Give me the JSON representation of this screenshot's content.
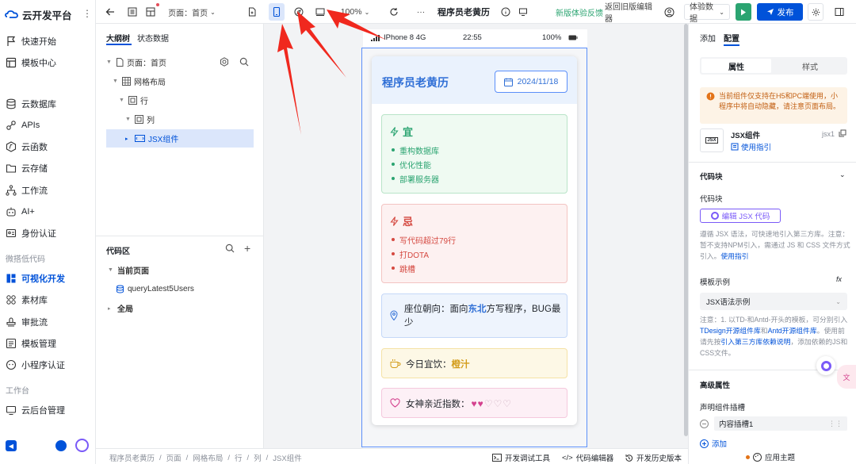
{
  "app": {
    "brand": "云开发平台"
  },
  "nav": {
    "items": [
      {
        "label": "快速开始"
      },
      {
        "label": "模板中心"
      },
      {
        "label": "云数据库"
      },
      {
        "label": "APIs"
      },
      {
        "label": "云函数"
      },
      {
        "label": "云存储"
      },
      {
        "label": "工作流"
      },
      {
        "label": "AI+"
      },
      {
        "label": "身份认证"
      },
      {
        "label": "可视化开发"
      },
      {
        "label": "素材库"
      },
      {
        "label": "审批流"
      },
      {
        "label": "模板管理"
      },
      {
        "label": "小程序认证"
      },
      {
        "label": "云后台管理"
      }
    ],
    "section_lowcode": "微搭低代码",
    "section_workbench": "工作台"
  },
  "topbar": {
    "page_select": "页面：首页",
    "zoom": "100%",
    "more": "···",
    "app_title": "程序员老黄历",
    "feedback": "新版体验反馈",
    "back_old": "返回旧版编辑器",
    "exp_data": "体验数据",
    "publish": "发布",
    "h5_tooltip": "H5"
  },
  "tree": {
    "tabs": [
      "大纲树",
      "状态数据"
    ],
    "rows": [
      {
        "label": "页面：首页"
      },
      {
        "label": "网格布局"
      },
      {
        "label": "行"
      },
      {
        "label": "列"
      },
      {
        "label": "JSX组件"
      }
    ],
    "code_title": "代码区",
    "code_rows": [
      {
        "label": "当前页面"
      },
      {
        "label": "queryLatest5Users"
      },
      {
        "label": "全局"
      }
    ]
  },
  "phone": {
    "status": {
      "device": "IPhone 8  4G",
      "time": "22:55",
      "battery": "100%"
    },
    "title": "程序员老黄历",
    "date": "2024/11/18",
    "yi": {
      "title": "宜",
      "items": [
        "重构数据库",
        "优化性能",
        "部署服务器"
      ]
    },
    "ji": {
      "title": "忌",
      "items": [
        "写代码超过79行",
        "打DOTA",
        "跳槽"
      ]
    },
    "seat": {
      "prefix": "座位朝向：面向",
      "dir": "东北",
      "suffix": "方写程序，BUG最少"
    },
    "drink": {
      "prefix": "今日宜饮：",
      "value": "橙汁"
    },
    "goddess": {
      "prefix": "女神亲近指数：",
      "filled": 2,
      "total": 5
    }
  },
  "right": {
    "tabs": [
      "添加",
      "配置"
    ],
    "subtabs": [
      "属性",
      "样式"
    ],
    "warning": "当前组件仅支持在H5和PC端使用，小程序中将自动隐藏，请注意页面布局。",
    "component_name": "JSX组件",
    "component_id": "jsx1",
    "component_badge": "JSX",
    "guide": "使用指引",
    "code_block_header": "代码块",
    "code_block_label": "代码块",
    "edit_jsx": "编辑 JSX 代码",
    "note1_a": "遵循 JSX 语法，可快速地引入第三方库。注意：暂不支持NPM引入，需通过 JS 和 CSS 文件方式引入。",
    "note1_link": "使用指引",
    "template_label": "模板示例",
    "fx": "fx",
    "template_select": "JSX语法示例",
    "note2_a": "注意：1. 以TD-和Antd-开头的模板，可分别引入",
    "note2_l1": "TDesign开源组件库",
    "note2_b": "和",
    "note2_l2": "Antd开源组件库",
    "note2_c": "。使用前请先按",
    "note2_l3": "引入第三方库依赖说明",
    "note2_d": "，添加依赖的JS和CSS文件。",
    "advanced": "高级属性",
    "slot_label": "声明组件插槽",
    "slot_value": "内容插槽1",
    "add": "添加",
    "theme": "应用主题"
  },
  "bottom": {
    "breadcrumb": [
      "程序员老黄历",
      "页面",
      "网格布局",
      "行",
      "列",
      "JSX组件"
    ],
    "debug": "开发调试工具",
    "code_editor": "代码编辑器",
    "history": "开发历史版本"
  },
  "colors": {
    "accent": "#0052d9",
    "green": "#2ba471",
    "red": "#d54941",
    "selected": "#dbe6fb"
  }
}
